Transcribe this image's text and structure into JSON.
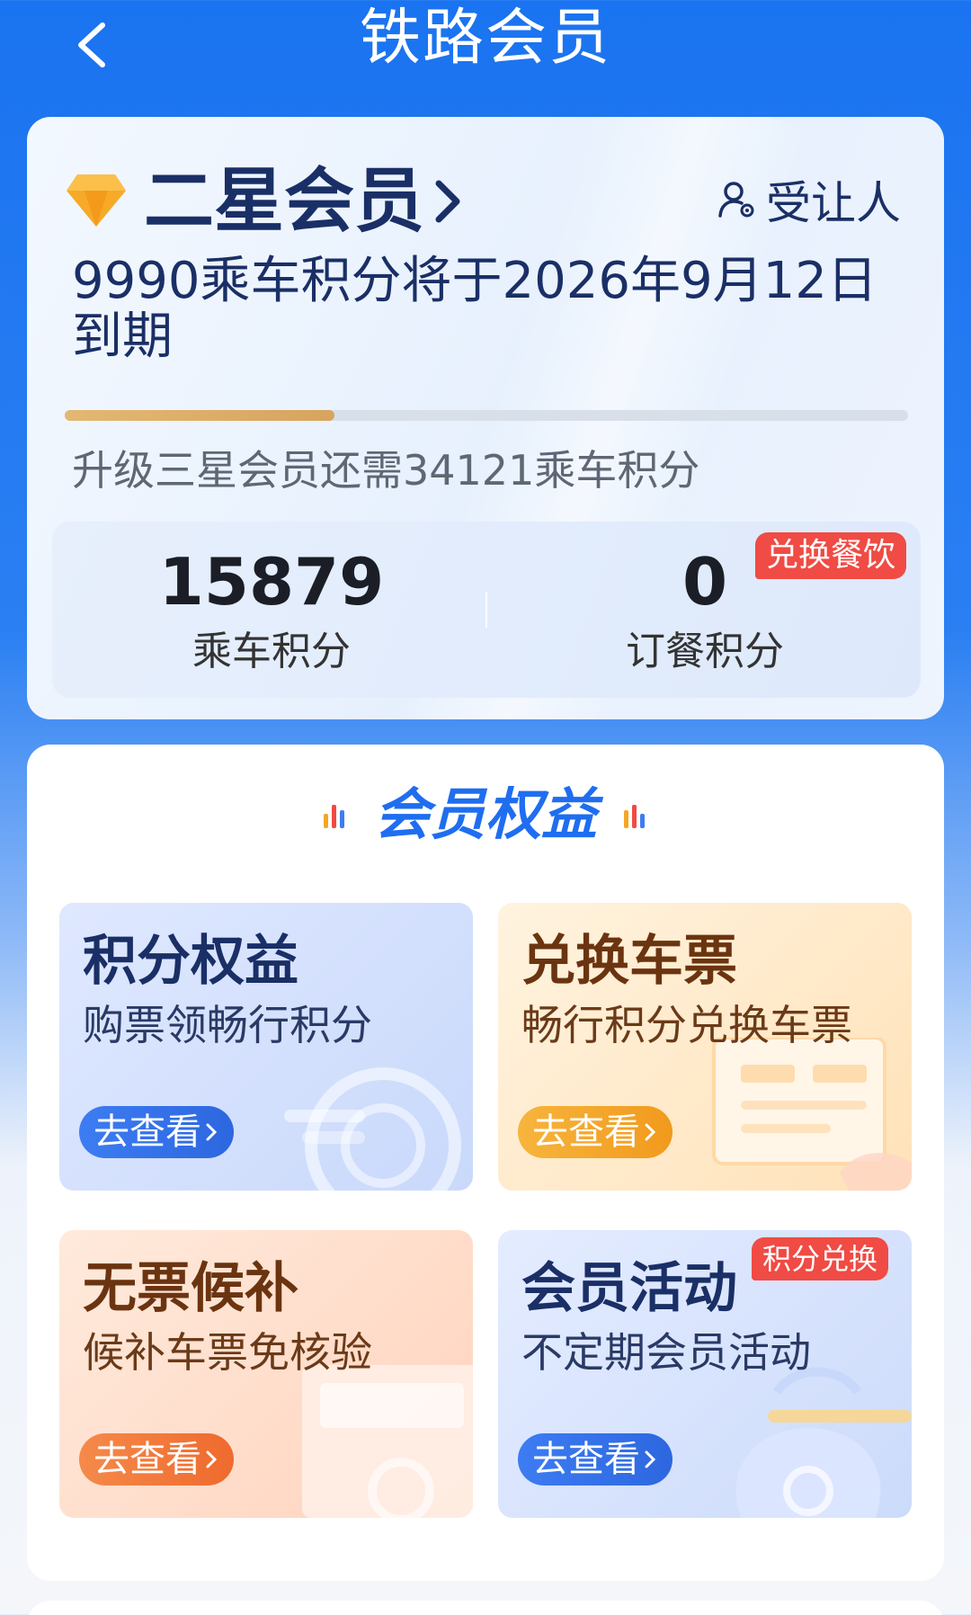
{
  "header": {
    "title": "铁路会员",
    "back_icon": "chevron-left-icon"
  },
  "member_card": {
    "level": "二星会员",
    "transferee_label": "受让人",
    "expiry_text": "9990乘车积分将于2026年9月12日到期",
    "progress_fraction": 0.32,
    "upgrade_text": "升级三星会员还需34121乘车积分",
    "ride_points_value": "15879",
    "ride_points_label": "乘车积分",
    "meal_points_value": "0",
    "meal_points_label": "订餐积分",
    "redeem_meal_badge": "兑换餐饮",
    "colors": {
      "progress": "#d8a45e",
      "text": "#1a2f66"
    }
  },
  "benefits": {
    "title": "会员权益",
    "tiles": [
      {
        "title": "积分权益",
        "subtitle": "购票领畅行积分",
        "button": "去查看"
      },
      {
        "title": "兑换车票",
        "subtitle": "畅行积分兑换车票",
        "button": "去查看"
      },
      {
        "title": "无票候补",
        "subtitle": "候补车票免核验",
        "button": "去查看"
      },
      {
        "title": "会员活动",
        "subtitle": "不定期会员活动",
        "button": "去查看",
        "badge": "积分兑换"
      }
    ],
    "colors": {
      "accent": "#1f6ef0",
      "badge": "#f04b44"
    }
  }
}
